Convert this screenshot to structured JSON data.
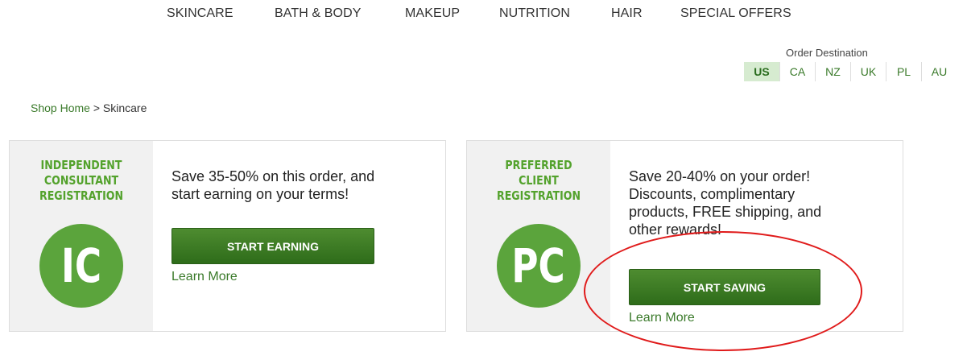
{
  "nav": {
    "items": [
      "SKINCARE",
      "BATH & BODY",
      "MAKEUP",
      "NUTRITION",
      "HAIR",
      "SPECIAL OFFERS"
    ]
  },
  "destination": {
    "label": "Order Destination",
    "options": [
      "US",
      "CA",
      "NZ",
      "UK",
      "PL",
      "AU"
    ],
    "selected": "US"
  },
  "breadcrumb": {
    "home": "Shop Home",
    "separator": " > ",
    "current": "Skincare"
  },
  "cards": [
    {
      "title_lines": [
        "INDEPENDENT",
        "CONSULTANT",
        "REGISTRATION"
      ],
      "badge": "IC",
      "text_lines": [
        "Save 35-50% on this order, and",
        "start earning on your terms!"
      ],
      "button": "START EARNING",
      "learn_more": "Learn More"
    },
    {
      "title_lines": [
        "PREFERRED",
        "CLIENT",
        "REGISTRATION"
      ],
      "badge": "PC",
      "text_lines": [
        "Save 20-40% on your order!",
        "Discounts, complimentary",
        "products, FREE shipping, and",
        "other rewards!"
      ],
      "button": "START SAVING",
      "learn_more": "Learn More"
    }
  ],
  "colors": {
    "brand_green": "#5ba43c",
    "button_green": "#3a7a24",
    "link_green": "#3a7a2a",
    "active_tab_bg": "#d6ebd0",
    "annotation_red": "#e01b1b"
  }
}
